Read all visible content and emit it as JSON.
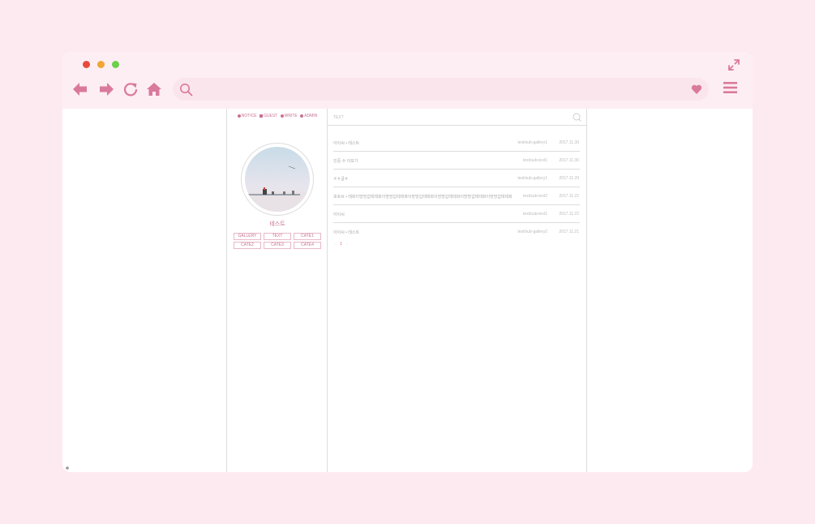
{
  "colors": {
    "accent": "#d97a9c",
    "chrome_bg": "#fdeef3",
    "page_bg": "#fdeaf0",
    "urlbar_bg": "#fbe5ec"
  },
  "icons": {
    "window_controls": [
      "close-dot",
      "minimize-dot",
      "maximize-dot"
    ],
    "expand": "expand-icon",
    "back": "arrow-left-icon",
    "forward": "arrow-right-icon",
    "reload": "reload-icon",
    "home": "home-icon",
    "search": "search-icon",
    "heart": "heart-icon",
    "menu": "hamburger-menu-icon"
  },
  "browser": {
    "url": "",
    "url_placeholder": ""
  },
  "sidebar": {
    "menu": [
      {
        "label": "NOTICE"
      },
      {
        "label": "GUEST"
      },
      {
        "label": "WRITE"
      },
      {
        "label": "ADMIN"
      }
    ],
    "blog_name": "테스트",
    "categories": [
      "GALLERY",
      "TEXT",
      "CATE1",
      "CATE2",
      "CATE3",
      "CATE4"
    ]
  },
  "main": {
    "title": "TEXT",
    "posts": [
      {
        "title": "아이씨 • 테스트",
        "category": "text/sub-gallery1",
        "date": "2017.11.30"
      },
      {
        "title": "민중 수 이보기",
        "category": "text/sub-text1",
        "date": "2017.11.30"
      },
      {
        "title": "ㅎㅎ글ㅎ",
        "category": "text/sub-gallery1",
        "date": "2017.11.29"
      },
      {
        "title": "호호브 • 테화이망망갑테테화이망망갑테테화이망망갑테테화이망망갑테테화이망망갑테테화이망망갑테테화...",
        "category": "text/sub-text2",
        "date": "2017.11.22"
      },
      {
        "title": "아이씨",
        "category": "text/sub-text1",
        "date": "2017.11.22"
      },
      {
        "title": "아이씨 • 테스트",
        "category": "text/sub-gallery2",
        "date": "2017.11.21"
      }
    ],
    "pager": {
      "prev": "‹",
      "current": "1",
      "next": "›"
    }
  }
}
